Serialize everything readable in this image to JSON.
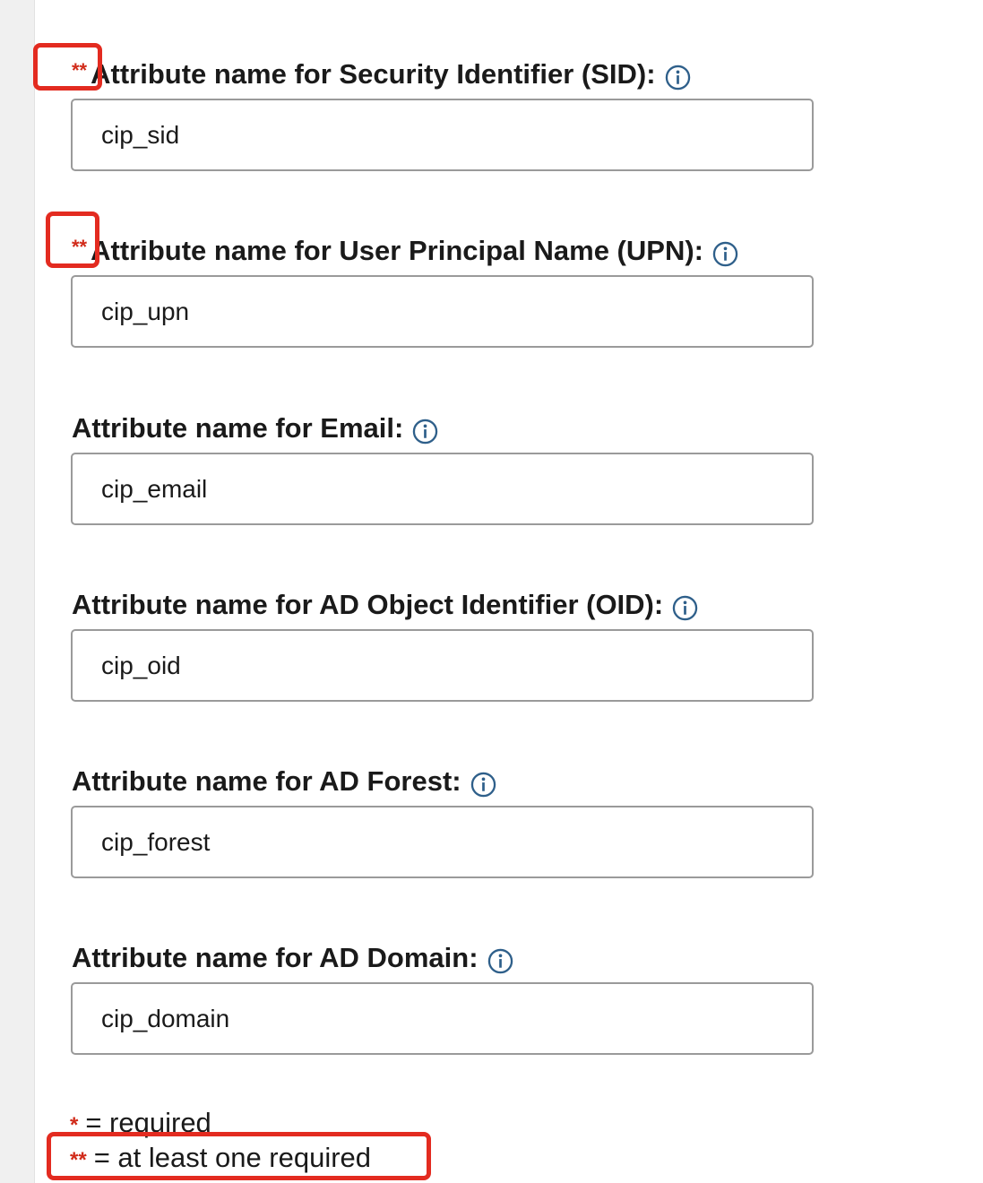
{
  "colors": {
    "star": "#d12b1a",
    "highlight": "#e32b20",
    "info_icon": "#2e5f8a"
  },
  "fields": [
    {
      "stars": "**",
      "label": "Attribute name for Security Identifier (SID):",
      "value": "cip_sid",
      "icon": "info-icon"
    },
    {
      "stars": "**",
      "label": "Attribute name for User Principal Name (UPN):",
      "value": "cip_upn",
      "icon": "info-icon"
    },
    {
      "stars": "",
      "label": "Attribute name for Email:",
      "value": "cip_email",
      "icon": "info-icon"
    },
    {
      "stars": "",
      "label": "Attribute name for AD Object Identifier (OID):",
      "value": "cip_oid",
      "icon": "info-icon"
    },
    {
      "stars": "",
      "label": "Attribute name for AD Forest:",
      "value": "cip_forest",
      "icon": "info-icon"
    },
    {
      "stars": "",
      "label": "Attribute name for AD Domain:",
      "value": "cip_domain",
      "icon": "info-icon"
    }
  ],
  "legend": {
    "required_symbol": "*",
    "required_text": "= required",
    "one_required_symbol": "**",
    "one_required_text": "= at least one required"
  }
}
